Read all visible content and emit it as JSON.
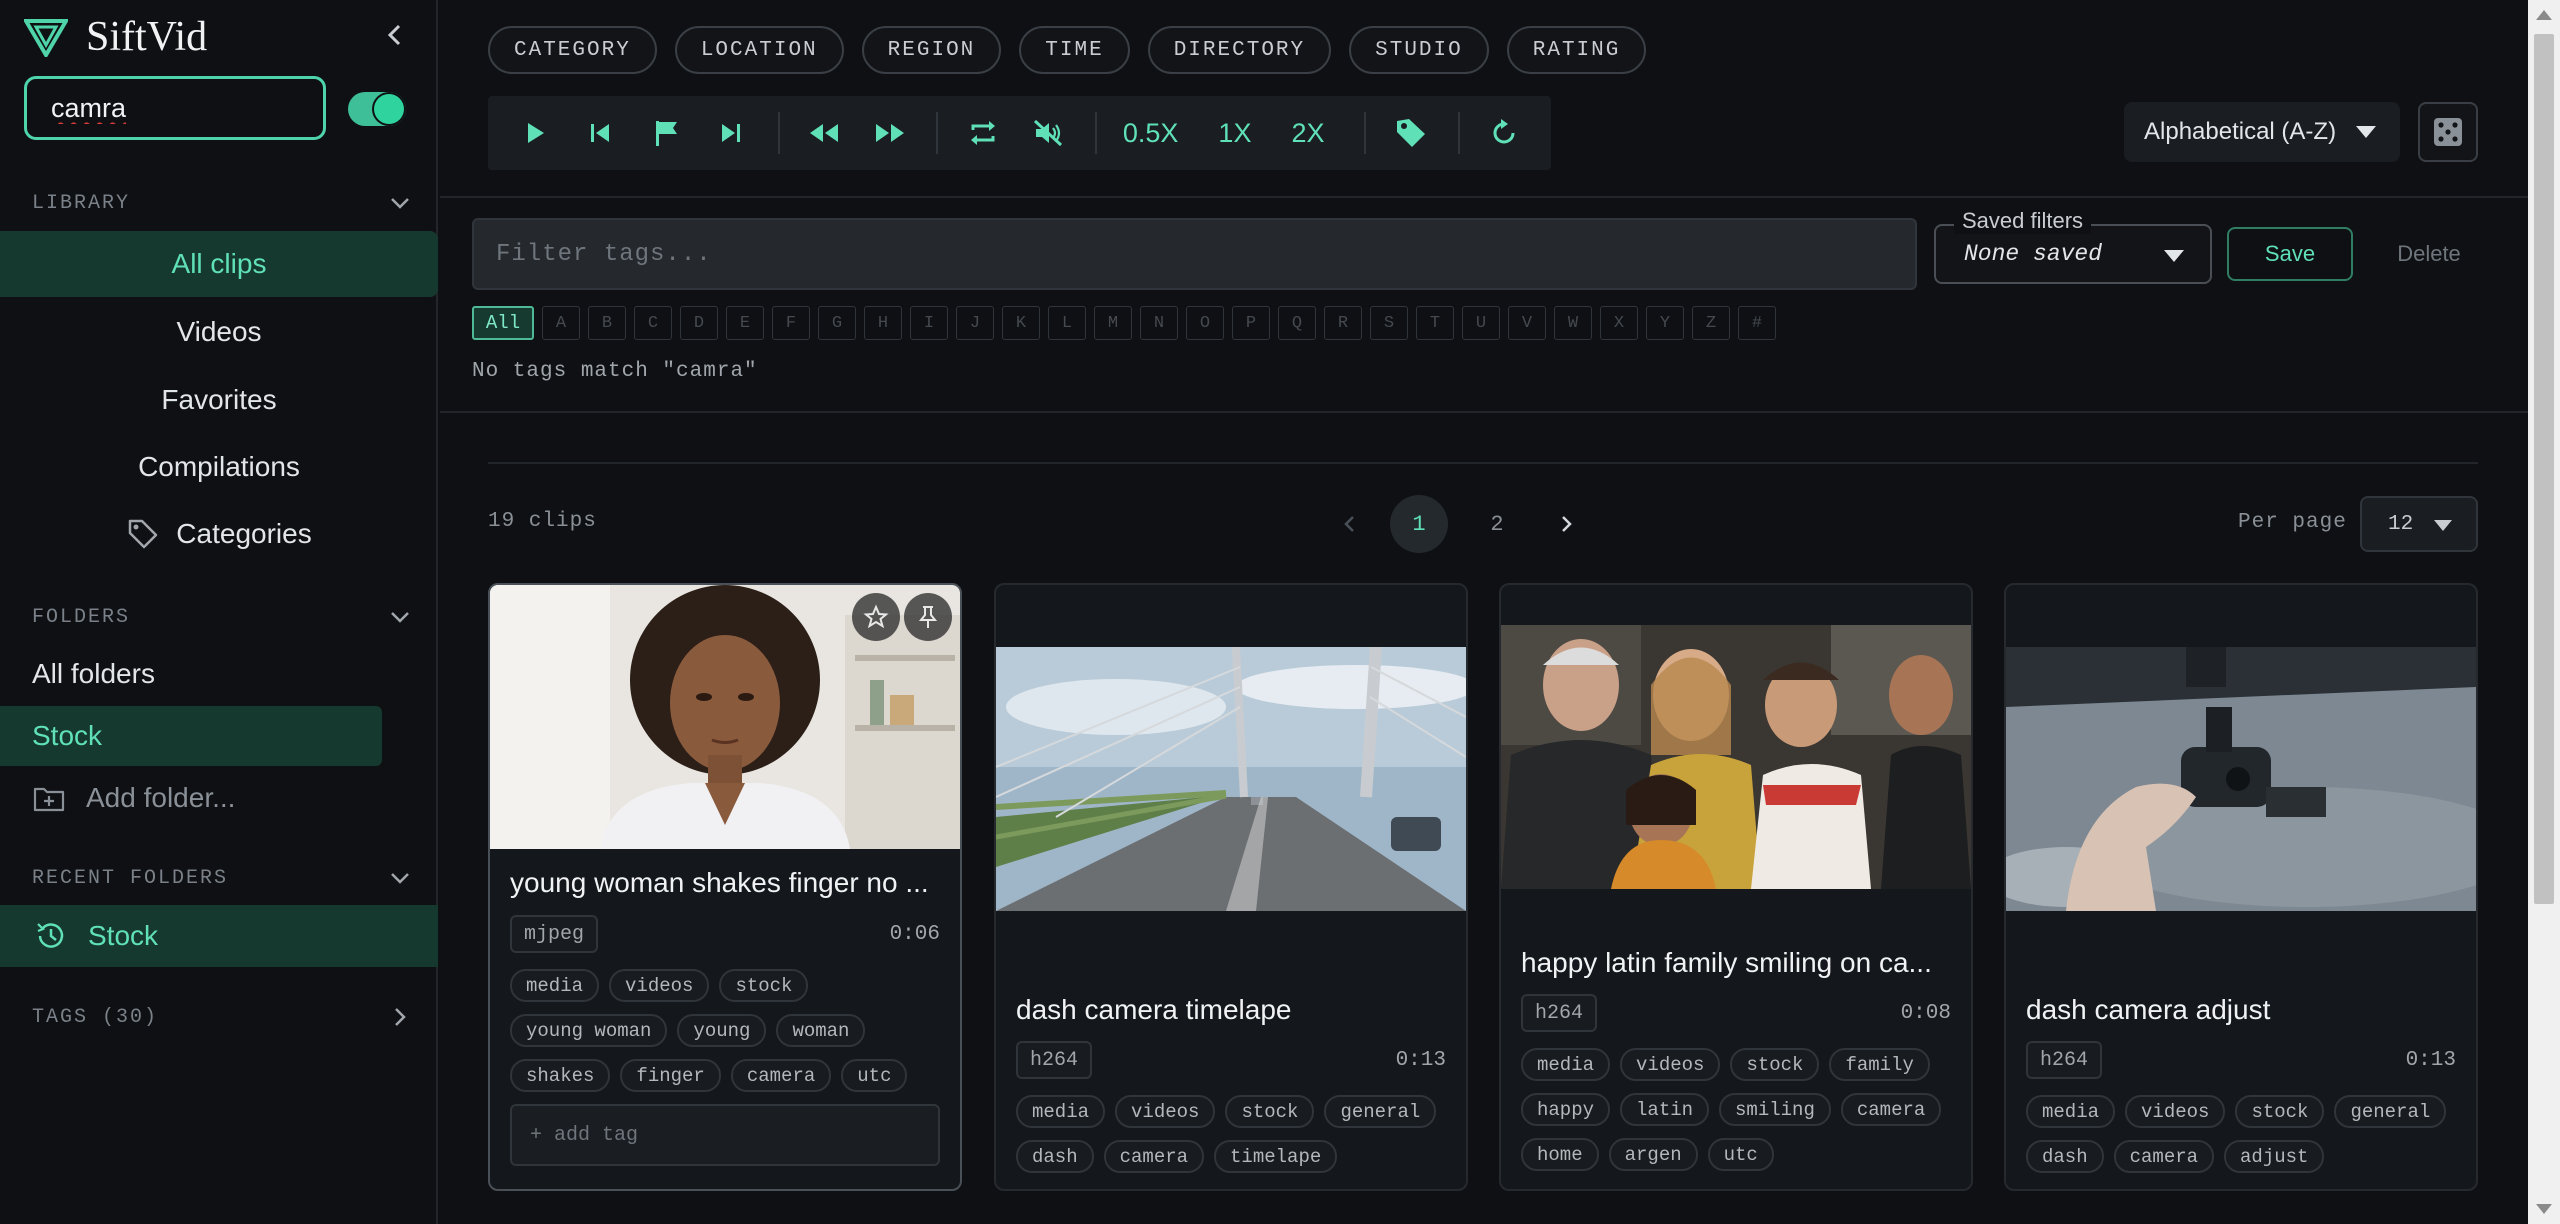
{
  "app": {
    "name": "SiftVid"
  },
  "search": {
    "value": "camra"
  },
  "sidebar": {
    "library_heading": "LIBRARY",
    "library_items": [
      {
        "label": "All clips",
        "active": true
      },
      {
        "label": "Videos"
      },
      {
        "label": "Favorites"
      },
      {
        "label": "Compilations"
      },
      {
        "label": "Categories",
        "icon": "tag-icon"
      }
    ],
    "folders_heading": "FOLDERS",
    "folder_items": [
      {
        "label": "All folders"
      },
      {
        "label": "Stock",
        "active": true
      },
      {
        "label": "Add folder...",
        "icon": "folder-plus-icon"
      }
    ],
    "recent_heading": "RECENT FOLDERS",
    "recent_items": [
      {
        "label": "Stock",
        "icon": "history-icon"
      }
    ],
    "tags_heading": "TAGS (30)"
  },
  "filter_chips": [
    "CATEGORY",
    "LOCATION",
    "REGION",
    "TIME",
    "DIRECTORY",
    "STUDIO",
    "RATING"
  ],
  "player": {
    "speeds": [
      "0.5X",
      "1X",
      "2X"
    ]
  },
  "sort": {
    "value": "Alphabetical (A-Z)"
  },
  "tag_filter": {
    "placeholder": "Filter tags...",
    "saved_label": "Saved filters",
    "saved_value": "None saved",
    "save_label": "Save",
    "delete_label": "Delete",
    "letters": [
      "All",
      "A",
      "B",
      "C",
      "D",
      "E",
      "F",
      "G",
      "H",
      "I",
      "J",
      "K",
      "L",
      "M",
      "N",
      "O",
      "P",
      "Q",
      "R",
      "S",
      "T",
      "U",
      "V",
      "W",
      "X",
      "Y",
      "Z",
      "#"
    ],
    "no_match": "No tags match \"camra\""
  },
  "results": {
    "count": "19 clips",
    "pages": [
      "1",
      "2"
    ],
    "current_page": "1",
    "per_page_label": "Per page",
    "per_page_value": "12"
  },
  "clips": [
    {
      "title": "young woman shakes finger no ...",
      "codec": "mjpeg",
      "duration": "0:06",
      "tags": [
        "media",
        "videos",
        "stock",
        "young woman",
        "young",
        "woman",
        "shakes",
        "finger",
        "camera",
        "utc"
      ],
      "add_tag": "+ add tag"
    },
    {
      "title": "dash camera timelape",
      "codec": "h264",
      "duration": "0:13",
      "tags": [
        "media",
        "videos",
        "stock",
        "general",
        "dash",
        "camera",
        "timelape"
      ]
    },
    {
      "title": "happy latin family smiling on ca...",
      "codec": "h264",
      "duration": "0:08",
      "tags": [
        "media",
        "videos",
        "stock",
        "family",
        "happy",
        "latin",
        "smiling",
        "camera",
        "home",
        "argen",
        "utc"
      ]
    },
    {
      "title": "dash camera adjust",
      "codec": "h264",
      "duration": "0:13",
      "tags": [
        "media",
        "videos",
        "stock",
        "general",
        "dash",
        "camera",
        "adjust"
      ]
    }
  ],
  "colors": {
    "accent": "#5fe0b6",
    "active_bg": "#16392f",
    "bg": "#0e1013"
  }
}
